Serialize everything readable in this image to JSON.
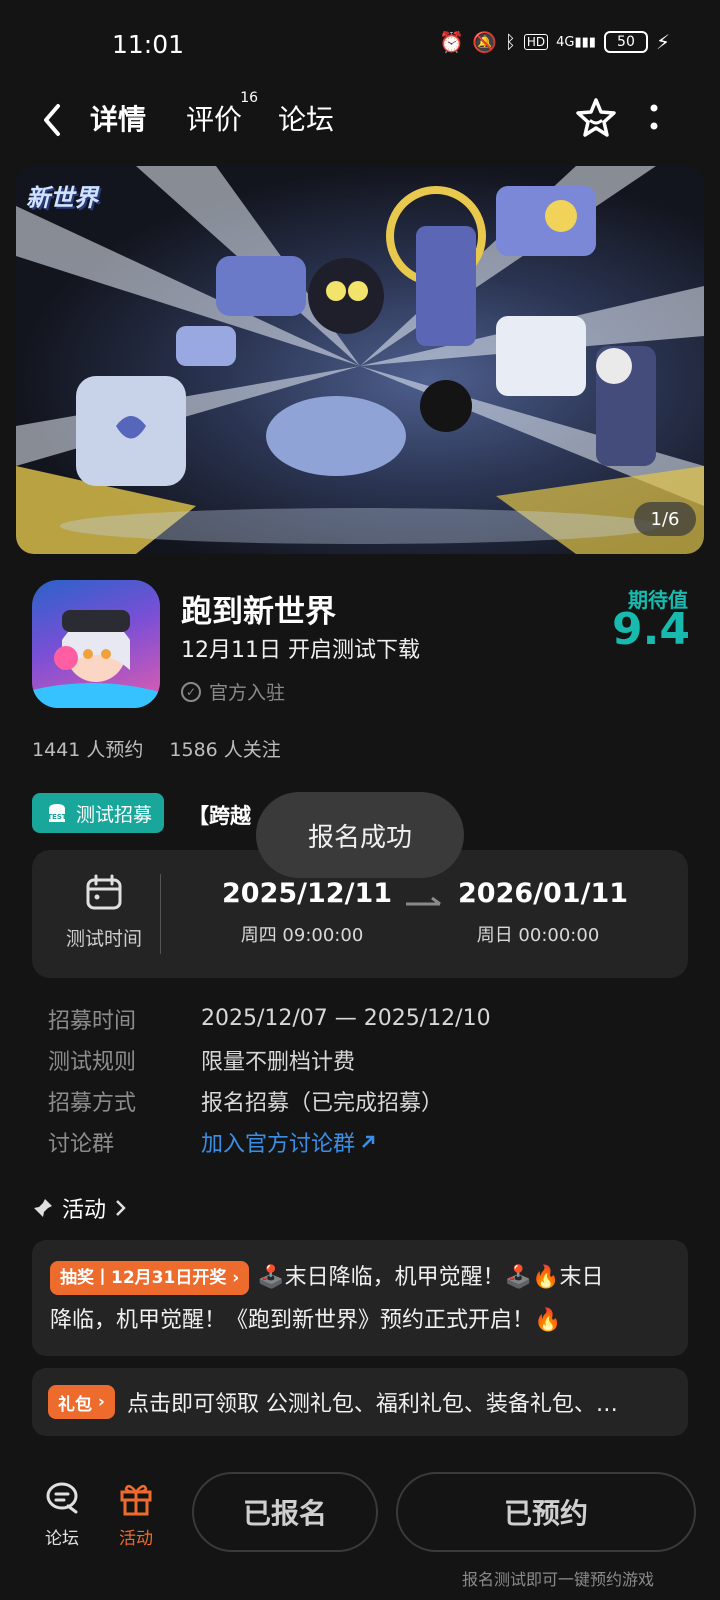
{
  "status_bar": {
    "time": "11:01",
    "battery": "50",
    "network": "4G",
    "hd": "HD"
  },
  "header": {
    "tabs": [
      {
        "label": "详情",
        "active": true
      },
      {
        "label": "评价",
        "badge": "16"
      },
      {
        "label": "论坛"
      }
    ],
    "icons": [
      "back-icon",
      "star-icon",
      "more-icon"
    ]
  },
  "banner": {
    "logo_text": "新世界",
    "counter": "1/6"
  },
  "game": {
    "title": "跑到新世界",
    "subtitle": "12月11日 开启测试下载",
    "official": "官方入驻",
    "expect_label": "期待值",
    "expect_score": "9.4",
    "reservations": "1441 人预约",
    "follows": "1586 人关注"
  },
  "recruit": {
    "tag": "测试招募",
    "title": "【跨越",
    "toast": "报名成功"
  },
  "test_time": {
    "label": "测试时间",
    "start_date": "2025/12/11",
    "start_sub": "周四  09:00:00",
    "end_date": "2026/01/11",
    "end_sub": "周日  00:00:00"
  },
  "info": [
    {
      "key": "招募时间",
      "value": "2025/12/07 — 2025/12/10"
    },
    {
      "key": "测试规则",
      "value": "限量不删档计费"
    },
    {
      "key": "招募方式",
      "value": "报名招募（已完成招募）"
    },
    {
      "key": "讨论群",
      "value": "加入官方讨论群"
    }
  ],
  "activity": {
    "title": "活动",
    "lottery_tag": "抽奖丨12月31日开奖",
    "lottery_text1": "🕹️末日降临，机甲觉醒！🕹️🔥末日",
    "lottery_text2": "降临，机甲觉醒！《跑到新世界》预约正式开启！🔥",
    "gift_tag": "礼包",
    "gift_text": "点击即可领取 公测礼包、福利礼包、装备礼包、…"
  },
  "bottom": {
    "nav_forum": "论坛",
    "nav_activity": "活动",
    "btn_registered": "已报名",
    "btn_reserved": "已预约",
    "hint": "报名测试即可一键预约游戏"
  },
  "colors": {
    "accent": "#16b7ad",
    "orange": "#ee6b2e",
    "link": "#3b8ee6",
    "background": "#141414",
    "card": "#242424"
  }
}
